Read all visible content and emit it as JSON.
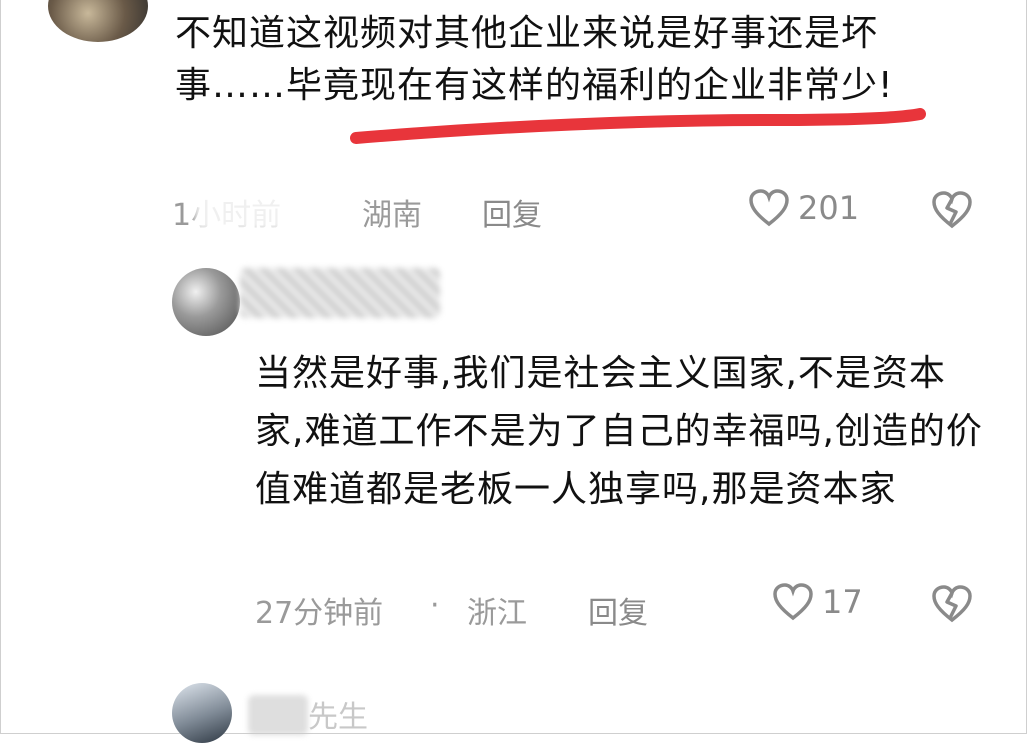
{
  "comments": [
    {
      "text": "不知道这视频对其他企业来说是好事还是坏事……毕竟现在有这样的福利的企业非常少!",
      "time": "1小时前",
      "location": "湖南",
      "reply_label": "回复",
      "likes": "201"
    },
    {
      "text": "当然是好事,我们是社会主义国家,不是资本家,难道工作不是为了自己的幸福吗,创造的价值难道都是老板一人独享吗,那是资本家",
      "time": "27分钟前",
      "separator": "·",
      "location": "浙江",
      "reply_label": "回复",
      "likes": "17"
    },
    {
      "partial_name": "先生"
    }
  ],
  "colors": {
    "underline": "#e8353b",
    "meta": "#9a9a9a",
    "text": "#111111"
  }
}
